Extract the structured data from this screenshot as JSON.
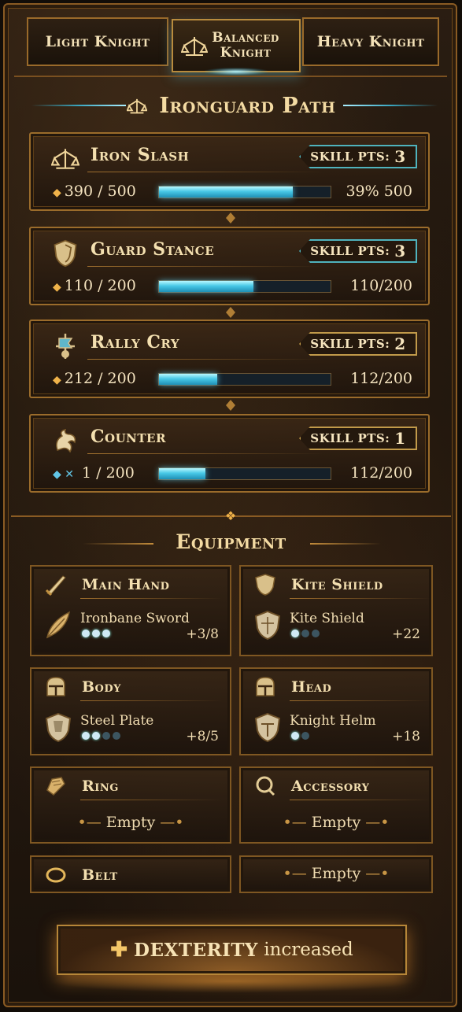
{
  "tabs": [
    {
      "label": "Light Knight",
      "selected": false
    },
    {
      "label": "Balanced Knight",
      "selected": true
    },
    {
      "label": "Heavy Knight",
      "selected": false
    }
  ],
  "path": {
    "title": "Ironguard Path",
    "icon": "balance-scale-icon"
  },
  "skills": [
    {
      "name": "Iron Slash",
      "icon": "balance-scale-icon",
      "points_label": "SKILL PTS:",
      "points": "3",
      "progress_left": "390 / 500",
      "progress_right": "39% 500",
      "fill": 0.78,
      "highlight": true
    },
    {
      "name": "Guard Stance",
      "icon": "shield-icon",
      "points_label": "SKILL PTS:",
      "points": "3",
      "progress_left": "110 / 200",
      "progress_right": "110/200",
      "fill": 0.55,
      "highlight": true
    },
    {
      "name": "Rally Cry",
      "icon": "rally-banner-icon",
      "points_label": "SKILL PTS:",
      "points": "2",
      "progress_left": "212 / 200",
      "progress_right": "112/200",
      "fill": 0.34,
      "highlight": false
    },
    {
      "name": "Counter",
      "icon": "dragon-icon",
      "points_label": "SKILL PTS:",
      "points": "1",
      "progress_left": "1 / 200",
      "progress_right": "112/200",
      "fill": 0.27,
      "highlight": false
    }
  ],
  "equipment": {
    "title": "Equipment",
    "slots": [
      {
        "slot": "Main Hand",
        "slot_icon": "sword-icon",
        "item": "Ironbane Sword",
        "item_icon": "feather-blade-icon",
        "gems": [
          1,
          1,
          1
        ],
        "bonus": "+3/8"
      },
      {
        "slot": "Kite Shield",
        "slot_icon": "kite-shield-icon",
        "item": "Kite Shield",
        "item_icon": "shield-icon",
        "gems": [
          1,
          0,
          0
        ],
        "bonus": "+22"
      },
      {
        "slot": "Body",
        "slot_icon": "helmet-icon",
        "item": "Steel Plate",
        "item_icon": "shield-icon",
        "gems": [
          1,
          1,
          0,
          0
        ],
        "bonus": "+8/5"
      },
      {
        "slot": "Head",
        "slot_icon": "helmet-icon",
        "item": "Knight Helm",
        "item_icon": "shield-icon",
        "gems": [
          1,
          0
        ],
        "bonus": "+18"
      },
      {
        "slot": "Ring",
        "slot_icon": "gauntlet-icon",
        "empty_label": "Empty"
      },
      {
        "slot": "Accessory",
        "slot_icon": "amulet-icon",
        "empty_label": "Empty"
      },
      {
        "slot": "Belt",
        "slot_icon": "belt-ring-icon"
      },
      {
        "empty_label": "Empty"
      }
    ]
  },
  "notification": {
    "stat": "DEXTERITY",
    "text": "increased",
    "icon": "plus-icon"
  },
  "colors": {
    "gold": "#f0b34a",
    "teal": "#48c8e6",
    "frame": "#9b6c2b",
    "bg": "#1c140c"
  }
}
